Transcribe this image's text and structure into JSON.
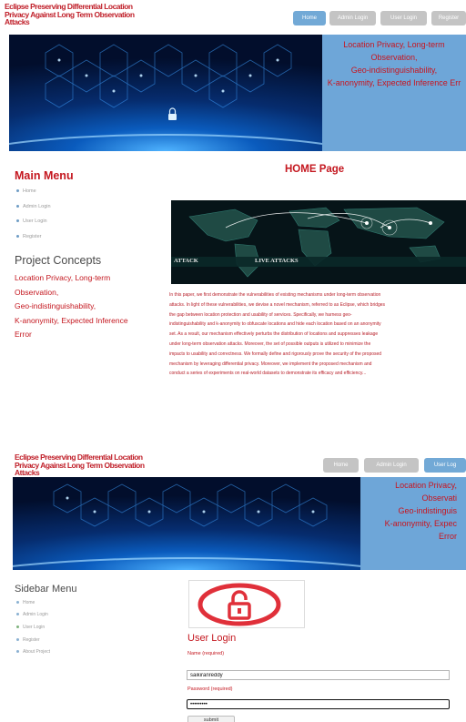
{
  "site": {
    "title_line1": "Eclipse Preserving Differential Location",
    "title_line2": "Privacy Against Long Term Observation",
    "title_line3": "Attacks"
  },
  "top_nav": [
    "Home",
    "Admin Login",
    "User Login",
    "Register"
  ],
  "bottom_nav": [
    "Home",
    "Admin Login",
    "User Log"
  ],
  "banner_top": {
    "lines": [
      "Location Privacy, Long-term",
      "Observation,",
      "Geo-indistinguishability,",
      "K-anonymity, Expected Inference Err"
    ]
  },
  "banner_bottom": {
    "lines": [
      "Location Privacy,",
      "Observati",
      "Geo-indistinguis",
      "K-anonymity, Expec",
      "Error"
    ]
  },
  "main_menu": {
    "title": "Main Menu",
    "items": [
      "Home",
      "Admin Login",
      "User Login",
      "Register"
    ]
  },
  "concepts": {
    "title": "Project Concepts",
    "lines": [
      "Location Privacy, Long-term",
      "Observation,",
      "Geo-indistinguishability,",
      "K-anonymity, Expected Inference",
      "Error"
    ]
  },
  "home": {
    "title": "HOME Page",
    "map_labels": [
      "ATTACK",
      "LIVE ATTACKS"
    ],
    "abstract_lines": [
      "In this paper, we first demonstrate the vulnerabilities of existing mechanisms under long-term observation",
      "attacks. In light of these vulnerabilities, we devise a novel mechanism, referred to as Eclipse, which bridges",
      "the gap between location protection and usability of services. Specifically, we harness geo-",
      "indistinguishability and k-anonymity to obfuscate locations and hide each location based on an anonymity",
      "set. As a result, our mechanism effectively perturbs the distribution of locations and suppresses leakage",
      "under long-term observation attacks. Moreover, the set of possible outputs is utilized to minimize the",
      "impacts to usability and correctness. We formally define and rigorously prove the security of the proposed",
      "mechanism by leveraging differential privacy. Moreover, we implement the proposed mechanism and",
      "conduct a series of experiments on real-world datasets to demonstrate its efficacy and efficiency..."
    ]
  },
  "sidebar": {
    "title": "Sidebar Menu",
    "items": [
      "Home",
      "Admin Login",
      "User Login",
      "Register",
      "About Project"
    ]
  },
  "login": {
    "title": "User Login",
    "name_label": "Name (required)",
    "name_value": "saikiranreddy",
    "password_label": "Password (required)",
    "password_value": "•••••••••",
    "submit_label": "submit"
  },
  "icons": {
    "lock": "lock-icon",
    "bullet": "bullet-icon"
  },
  "colors": {
    "accent_red": "#c4171f",
    "nav_active": "#72a9d6",
    "nav_idle": "#c4c4c4",
    "banner_panel": "#6ea6d8"
  }
}
